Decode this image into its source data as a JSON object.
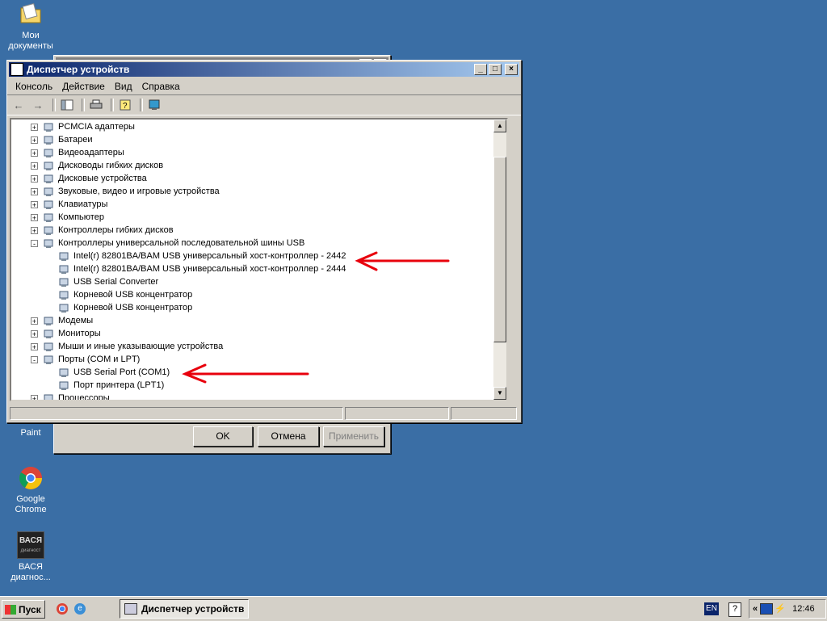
{
  "desktop": {
    "icons": [
      {
        "label_1": "Мои",
        "label_2": "документы",
        "icon": "my-documents-icon"
      },
      {
        "label_1": "Paint",
        "icon": "paint-icon"
      },
      {
        "label_1": "Google Chrome",
        "icon": "chrome-icon"
      },
      {
        "label_1": "ВАСЯ",
        "label_2": "диагнос...",
        "icon": "vasya-diagnostics-icon",
        "badge_1": "ВАСЯ",
        "badge_2": "диагност"
      }
    ]
  },
  "device_manager": {
    "title": "Диспетчер устройств",
    "menu": [
      "Консоль",
      "Действие",
      "Вид",
      "Справка"
    ],
    "tree": [
      {
        "label": "PCMCIA адаптеры",
        "level": 1,
        "expand": "+"
      },
      {
        "label": "Батареи",
        "level": 1,
        "expand": "+"
      },
      {
        "label": "Видеоадаптеры",
        "level": 1,
        "expand": "+"
      },
      {
        "label": "Дисководы гибких дисков",
        "level": 1,
        "expand": "+"
      },
      {
        "label": "Дисковые устройства",
        "level": 1,
        "expand": "+"
      },
      {
        "label": "Звуковые, видео и игровые устройства",
        "level": 1,
        "expand": "+"
      },
      {
        "label": "Клавиатуры",
        "level": 1,
        "expand": "+"
      },
      {
        "label": "Компьютер",
        "level": 1,
        "expand": "+"
      },
      {
        "label": "Контроллеры гибких дисков",
        "level": 1,
        "expand": "+"
      },
      {
        "label": "Контроллеры универсальной последовательной шины USB",
        "level": 1,
        "expand": "-"
      },
      {
        "label": "Intel(r) 82801BA/BAM USB универсальный хост-контроллер - 2442",
        "level": 2
      },
      {
        "label": "Intel(r) 82801BA/BAM USB универсальный хост-контроллер - 2444",
        "level": 2
      },
      {
        "label": "USB Serial Converter",
        "level": 2
      },
      {
        "label": "Корневой USB концентратор",
        "level": 2
      },
      {
        "label": "Корневой USB концентратор",
        "level": 2
      },
      {
        "label": "Модемы",
        "level": 1,
        "expand": "+"
      },
      {
        "label": "Мониторы",
        "level": 1,
        "expand": "+"
      },
      {
        "label": "Мыши и иные указывающие устройства",
        "level": 1,
        "expand": "+"
      },
      {
        "label": "Порты (COM и LPT)",
        "level": 1,
        "expand": "-"
      },
      {
        "label": "USB Serial Port (COM1)",
        "level": 2
      },
      {
        "label": "Порт принтера (LPT1)",
        "level": 2
      },
      {
        "label": "Процессоры",
        "level": 1,
        "expand": "+"
      }
    ]
  },
  "dialog_behind": {
    "ok": "OK",
    "cancel": "Отмена",
    "apply": "Применить"
  },
  "taskbar": {
    "start": "Пуск",
    "task": "Диспетчер устройств",
    "lang": "EN",
    "help": "?",
    "chevron": "«",
    "clock": "12:46"
  },
  "colors": {
    "desktop": "#3a6ea5",
    "annotation_arrow": "#e8000c"
  }
}
